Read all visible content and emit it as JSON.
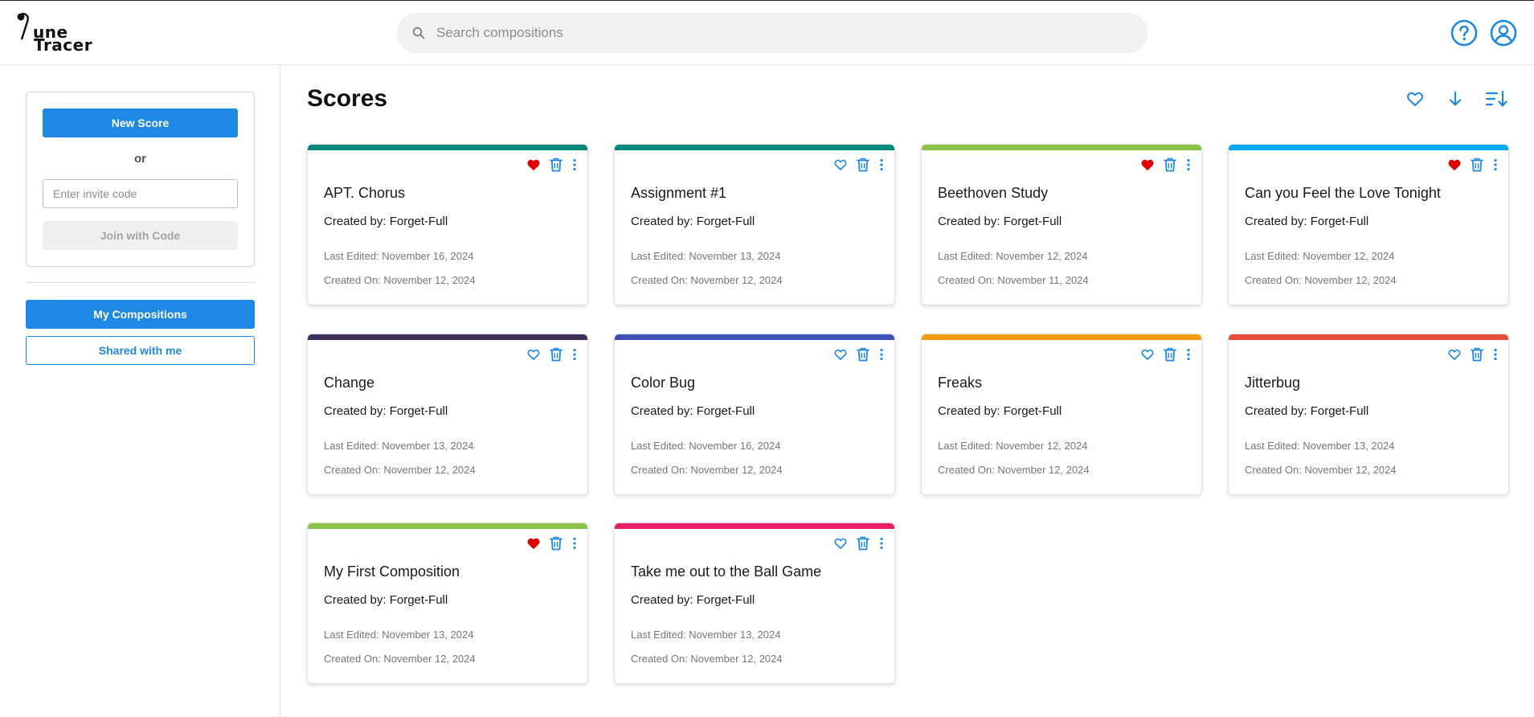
{
  "app": {
    "logo_line1": "une",
    "logo_line2": "Tracer"
  },
  "search": {
    "placeholder": "Search compositions",
    "value": ""
  },
  "header": {
    "help_icon": "help-circle-icon",
    "account_icon": "account-circle-icon"
  },
  "sidebar": {
    "new_score_label": "New Score",
    "or_label": "or",
    "invite_placeholder": "Enter invite code",
    "invite_value": "",
    "join_label": "Join with Code",
    "nav": [
      {
        "label": "My Compositions",
        "active": true
      },
      {
        "label": "Shared with me",
        "active": false
      }
    ]
  },
  "main": {
    "title": "Scores",
    "toolbar": {
      "favorite_filter_icon": "heart-outline-icon",
      "sort_direction_icon": "arrow-down-icon",
      "sort_menu_icon": "sort-lines-icon"
    },
    "cards": [
      {
        "title": "APT. Chorus",
        "created_by": "Created by: Forget-Full",
        "last_edited": "Last Edited: November 16, 2024",
        "created_on": "Created On: November 12, 2024",
        "color": "#00897b",
        "favorite": true
      },
      {
        "title": "Assignment #1",
        "created_by": "Created by: Forget-Full",
        "last_edited": "Last Edited: November 13, 2024",
        "created_on": "Created On: November 12, 2024",
        "color": "#00897b",
        "favorite": false
      },
      {
        "title": "Beethoven Study",
        "created_by": "Created by: Forget-Full",
        "last_edited": "Last Edited: November 12, 2024",
        "created_on": "Created On: November 11, 2024",
        "color": "#8bc34a",
        "favorite": true
      },
      {
        "title": "Can you Feel the Love Tonight",
        "created_by": "Created by: Forget-Full",
        "last_edited": "Last Edited: November 12, 2024",
        "created_on": "Created On: November 12, 2024",
        "color": "#03a9f4",
        "favorite": true
      },
      {
        "title": "Change",
        "created_by": "Created by: Forget-Full",
        "last_edited": "Last Edited: November 13, 2024",
        "created_on": "Created On: November 12, 2024",
        "color": "#3c2f5c",
        "favorite": false
      },
      {
        "title": "Color Bug",
        "created_by": "Created by: Forget-Full",
        "last_edited": "Last Edited: November 16, 2024",
        "created_on": "Created On: November 12, 2024",
        "color": "#3f51b5",
        "favorite": false
      },
      {
        "title": "Freaks",
        "created_by": "Created by: Forget-Full",
        "last_edited": "Last Edited: November 12, 2024",
        "created_on": "Created On: November 12, 2024",
        "color": "#f39c12",
        "favorite": false
      },
      {
        "title": "Jitterbug",
        "created_by": "Created by: Forget-Full",
        "last_edited": "Last Edited: November 13, 2024",
        "created_on": "Created On: November 12, 2024",
        "color": "#e84c3d",
        "favorite": false
      },
      {
        "title": "My First Composition",
        "created_by": "Created by: Forget-Full",
        "last_edited": "Last Edited: November 13, 2024",
        "created_on": "Created On: November 12, 2024",
        "color": "#8bc34a",
        "favorite": true
      },
      {
        "title": "Take me out to the Ball Game",
        "created_by": "Created by: Forget-Full",
        "last_edited": "Last Edited: November 13, 2024",
        "created_on": "Created On: November 12, 2024",
        "color": "#e91e63",
        "favorite": false
      }
    ]
  },
  "colors": {
    "accent": "#1e88e5",
    "favorite": "#e00000",
    "icon": "#1e88e5"
  }
}
